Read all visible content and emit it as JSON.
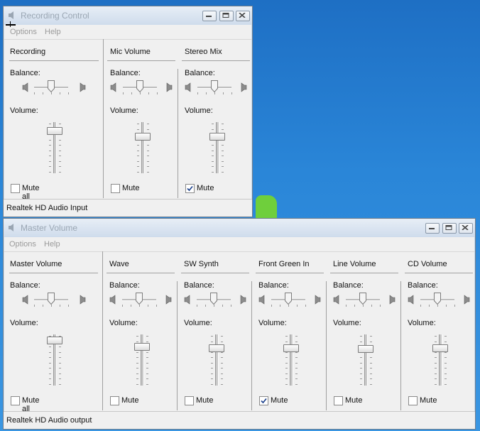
{
  "recording": {
    "title": "Recording Control",
    "menu": [
      "Options",
      "Help"
    ],
    "columns": [
      {
        "title": "Recording",
        "mute_label": "Mute all",
        "muted": false
      },
      {
        "title": "Mic Volume",
        "mute_label": "Mute",
        "muted": false
      },
      {
        "title": "Stereo Mix",
        "mute_label": "Mute",
        "muted": true
      }
    ],
    "balance_label": "Balance:",
    "volume_label": "Volume:",
    "status": "Realtek HD Audio Input"
  },
  "master": {
    "title": "Master Volume",
    "menu": [
      "Options",
      "Help"
    ],
    "columns": [
      {
        "title": "Master Volume",
        "mute_label": "Mute all",
        "muted": false
      },
      {
        "title": "Wave",
        "mute_label": "Mute",
        "muted": false
      },
      {
        "title": "SW Synth",
        "mute_label": "Mute",
        "muted": false
      },
      {
        "title": "Front Green In",
        "mute_label": "Mute",
        "muted": true
      },
      {
        "title": "Line Volume",
        "mute_label": "Mute",
        "muted": false
      },
      {
        "title": "CD Volume",
        "mute_label": "Mute",
        "muted": false
      }
    ],
    "balance_label": "Balance:",
    "volume_label": "Volume:",
    "status": "Realtek HD Audio output"
  },
  "title_buttons": {
    "minimize": "minimize-icon",
    "restore": "restore-icon",
    "close": "close-icon"
  }
}
